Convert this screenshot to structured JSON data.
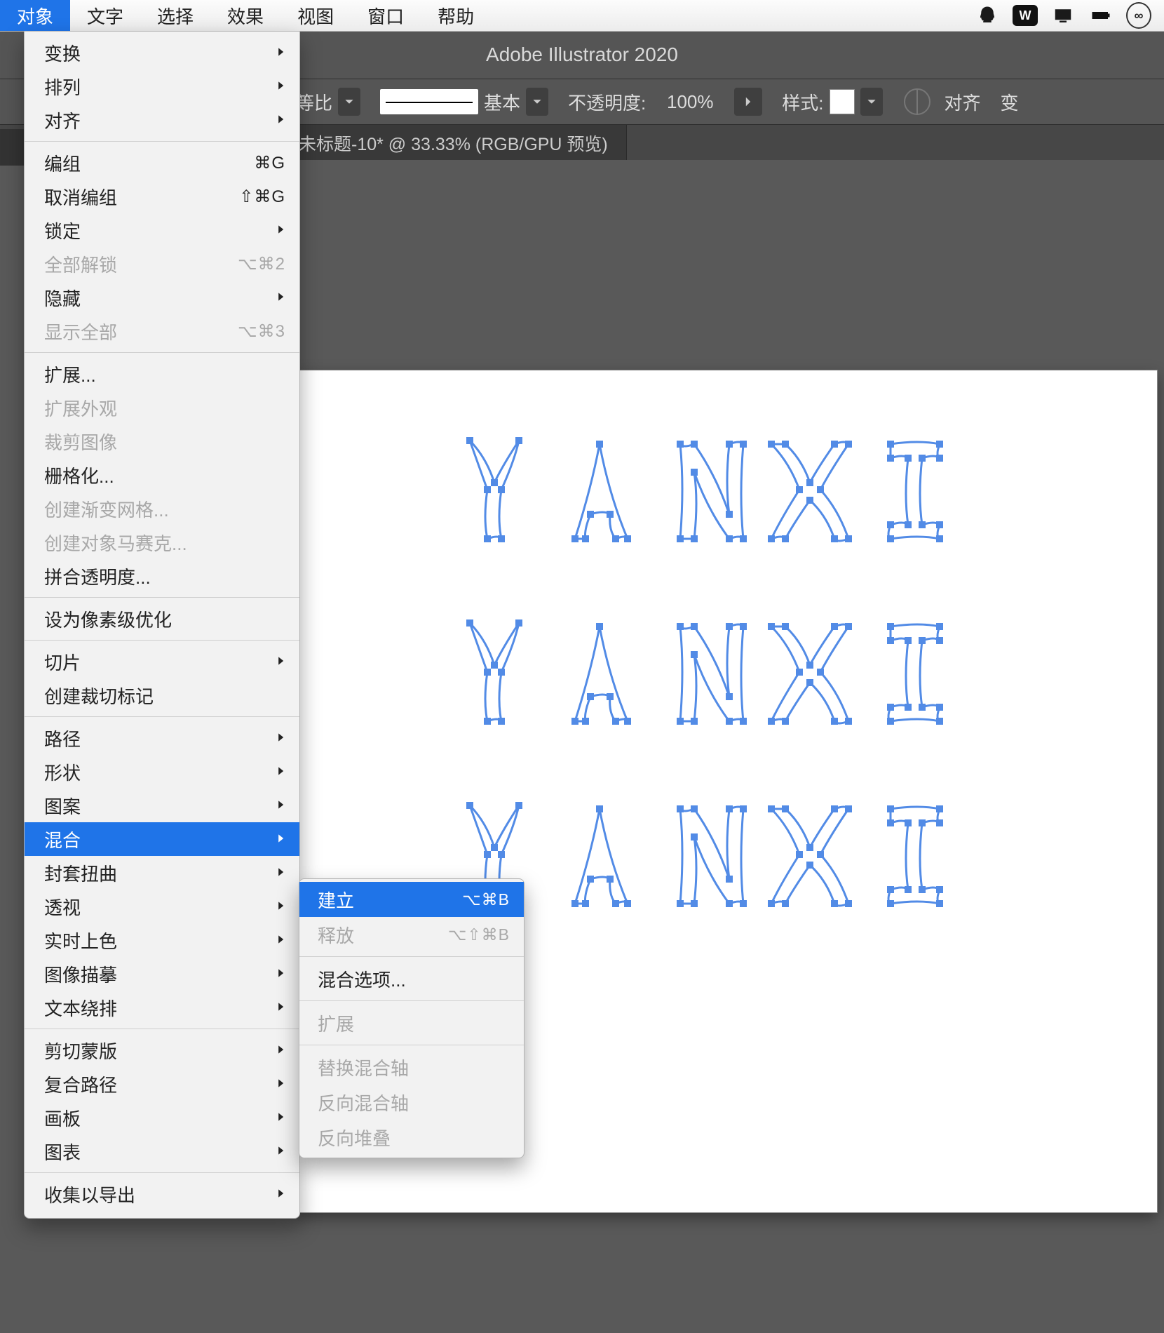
{
  "menubar": {
    "items": [
      "对象",
      "文字",
      "选择",
      "效果",
      "视图",
      "窗口",
      "帮助"
    ],
    "active_index": 0
  },
  "tray": {
    "wps": "W",
    "cc": "∞"
  },
  "app_title": "Adobe Illustrator 2020",
  "controlbar": {
    "scale_mode": "等比",
    "stroke_label": "基本",
    "opacity_label": "不透明度:",
    "opacity_value": "100%",
    "style_label": "样式:",
    "align_label": "对齐",
    "transform_label": "变"
  },
  "document_tab": "未标题-10* @ 33.33% (RGB/GPU 预览)",
  "canvas_text": "YANXI",
  "menu": {
    "sections": [
      [
        {
          "label": "变换",
          "submenu": true
        },
        {
          "label": "排列",
          "submenu": true
        },
        {
          "label": "对齐",
          "submenu": true
        }
      ],
      [
        {
          "label": "编组",
          "shortcut": "⌘G"
        },
        {
          "label": "取消编组",
          "shortcut": "⇧⌘G"
        },
        {
          "label": "锁定",
          "submenu": true
        },
        {
          "label": "全部解锁",
          "shortcut": "⌥⌘2",
          "disabled": true
        },
        {
          "label": "隐藏",
          "submenu": true
        },
        {
          "label": "显示全部",
          "shortcut": "⌥⌘3",
          "disabled": true
        }
      ],
      [
        {
          "label": "扩展..."
        },
        {
          "label": "扩展外观",
          "disabled": true
        },
        {
          "label": "裁剪图像",
          "disabled": true
        },
        {
          "label": "栅格化..."
        },
        {
          "label": "创建渐变网格...",
          "disabled": true
        },
        {
          "label": "创建对象马赛克...",
          "disabled": true
        },
        {
          "label": "拼合透明度..."
        }
      ],
      [
        {
          "label": "设为像素级优化"
        }
      ],
      [
        {
          "label": "切片",
          "submenu": true
        },
        {
          "label": "创建裁切标记"
        }
      ],
      [
        {
          "label": "路径",
          "submenu": true
        },
        {
          "label": "形状",
          "submenu": true
        },
        {
          "label": "图案",
          "submenu": true
        },
        {
          "label": "混合",
          "submenu": true,
          "highlight": true
        },
        {
          "label": "封套扭曲",
          "submenu": true
        },
        {
          "label": "透视",
          "submenu": true
        },
        {
          "label": "实时上色",
          "submenu": true
        },
        {
          "label": "图像描摹",
          "submenu": true
        },
        {
          "label": "文本绕排",
          "submenu": true
        }
      ],
      [
        {
          "label": "剪切蒙版",
          "submenu": true
        },
        {
          "label": "复合路径",
          "submenu": true
        },
        {
          "label": "画板",
          "submenu": true
        },
        {
          "label": "图表",
          "submenu": true
        }
      ],
      [
        {
          "label": "收集以导出",
          "submenu": true
        }
      ]
    ]
  },
  "submenu": {
    "sections": [
      [
        {
          "label": "建立",
          "shortcut": "⌥⌘B",
          "highlight": true
        },
        {
          "label": "释放",
          "shortcut": "⌥⇧⌘B",
          "disabled": true
        }
      ],
      [
        {
          "label": "混合选项..."
        }
      ],
      [
        {
          "label": "扩展",
          "disabled": true
        }
      ],
      [
        {
          "label": "替换混合轴",
          "disabled": true
        },
        {
          "label": "反向混合轴",
          "disabled": true
        },
        {
          "label": "反向堆叠",
          "disabled": true
        }
      ]
    ]
  }
}
